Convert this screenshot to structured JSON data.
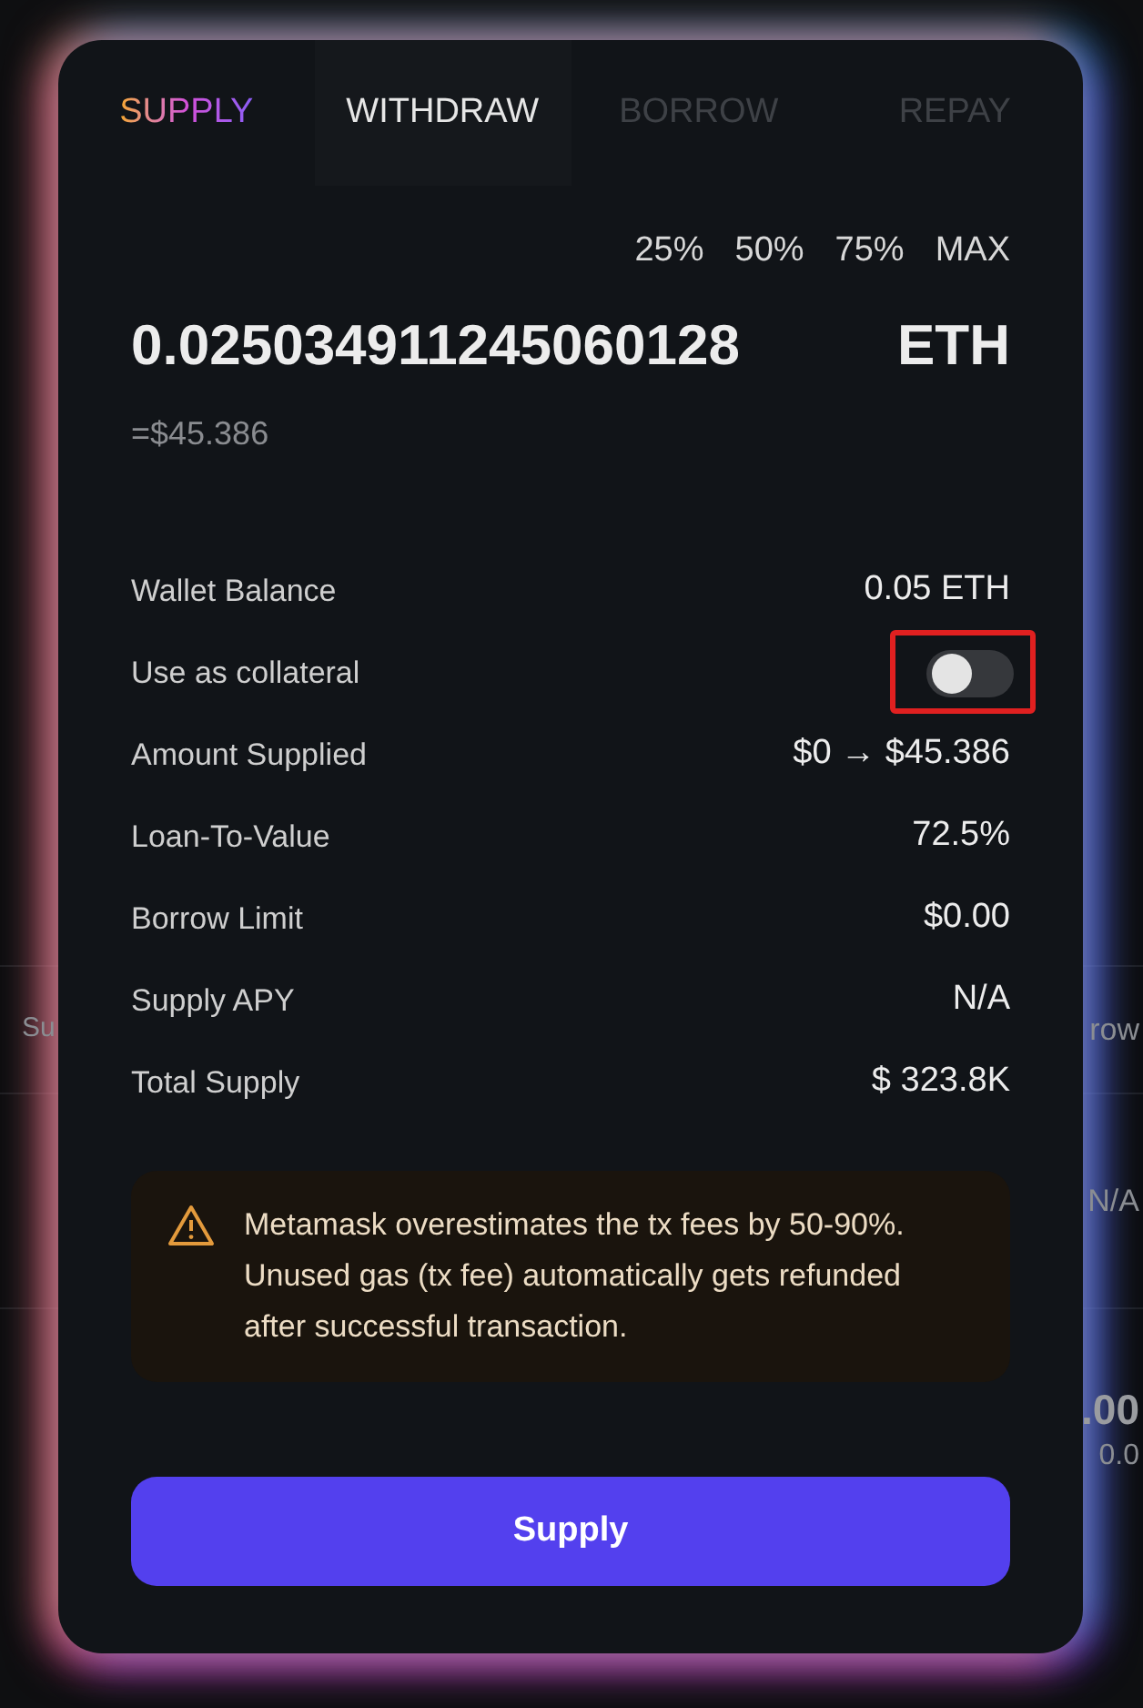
{
  "background": {
    "rows": [
      {
        "left": "Su",
        "right": "row"
      },
      {
        "left": "",
        "right": "N/A"
      }
    ],
    "amount_row": {
      "value": ".00",
      "sub": "0.0"
    }
  },
  "modal": {
    "tabs": [
      {
        "label": "SUPPLY",
        "selected": true,
        "disabled": false
      },
      {
        "label": "WITHDRAW",
        "selected": false,
        "disabled": false
      },
      {
        "label": "BORROW",
        "selected": false,
        "disabled": true
      },
      {
        "label": "REPAY",
        "selected": false,
        "disabled": true
      }
    ],
    "presets": [
      "25%",
      "50%",
      "75%",
      "MAX"
    ],
    "amount": "0.025034911245060128",
    "token": "ETH",
    "usd_value": "=$45.386",
    "details": [
      {
        "kind": "text",
        "label": "Wallet Balance",
        "value": "0.05 ETH"
      },
      {
        "kind": "toggle",
        "label": "Use as collateral",
        "on": false,
        "highlighted": true
      },
      {
        "kind": "text",
        "label": "Amount Supplied",
        "value": "$0 → $45.386"
      },
      {
        "kind": "text",
        "label": "Loan-To-Value",
        "value": "72.5%"
      },
      {
        "kind": "text",
        "label": "Borrow Limit",
        "value": "$0.00"
      },
      {
        "kind": "text",
        "label": "Supply APY",
        "value": "N/A"
      },
      {
        "kind": "text",
        "label": "Total Supply",
        "value": "$ 323.8K"
      }
    ],
    "warning": "Metamask overestimates the tx fees by 50-90%. Unused gas (tx fee) automatically gets refunded after successful transaction.",
    "button": "Supply"
  }
}
